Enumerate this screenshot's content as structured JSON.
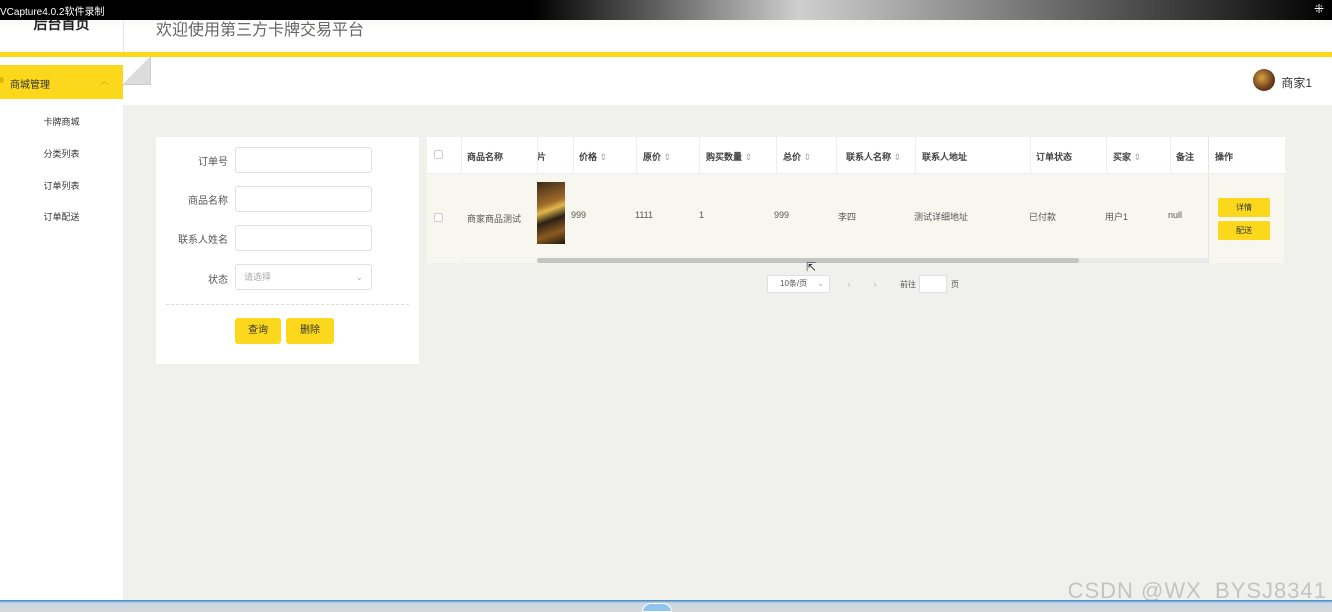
{
  "recorder": {
    "title": "VCapture4.0.2软件录制"
  },
  "header": {
    "brand": "后台首页",
    "welcome": "欢迎使用第三方卡牌交易平台"
  },
  "sidebar": {
    "group_label": "商城管理",
    "items": [
      {
        "label": "卡牌商城"
      },
      {
        "label": "分类列表"
      },
      {
        "label": "订单列表"
      },
      {
        "label": "订单配送"
      }
    ]
  },
  "user": {
    "name": "商家1"
  },
  "search": {
    "fields": [
      {
        "label": "订单号",
        "value": ""
      },
      {
        "label": "商品名称",
        "value": ""
      },
      {
        "label": "联系人姓名",
        "value": ""
      }
    ],
    "status_label": "状态",
    "status_placeholder": "请选择",
    "query_button": "查询",
    "delete_button": "删除"
  },
  "table": {
    "columns": [
      {
        "label": "商品名称",
        "sort": ""
      },
      {
        "label": "片",
        "sort": ""
      },
      {
        "label": "价格",
        "sort": "⇕"
      },
      {
        "label": "原价",
        "sort": "⇕"
      },
      {
        "label": "购买数量",
        "sort": "⇕"
      },
      {
        "label": "总价",
        "sort": "⇕"
      },
      {
        "label": "联系人名称",
        "sort": "⇕"
      },
      {
        "label": "联系人地址",
        "sort": ""
      },
      {
        "label": "订单状态",
        "sort": ""
      },
      {
        "label": "买家",
        "sort": "⇕"
      },
      {
        "label": "备注",
        "sort": ""
      }
    ],
    "action_header": "操作",
    "rows": [
      {
        "name": "商家商品测试",
        "price": "999",
        "original_price": "1111",
        "quantity": "1",
        "total": "999",
        "contact_name": "李四",
        "contact_address": "测试详细地址",
        "status": "已付款",
        "buyer": "用户1",
        "remark": "null",
        "actions": [
          "详情",
          "配送"
        ]
      }
    ]
  },
  "pagination": {
    "page_size": "10条/页",
    "prev": "‹",
    "next": "›",
    "goto_label": "前往",
    "page_unit": "页"
  },
  "watermark": "CSDN @WX_BYSJ8341",
  "colors": {
    "accent": "#fcd81c"
  }
}
